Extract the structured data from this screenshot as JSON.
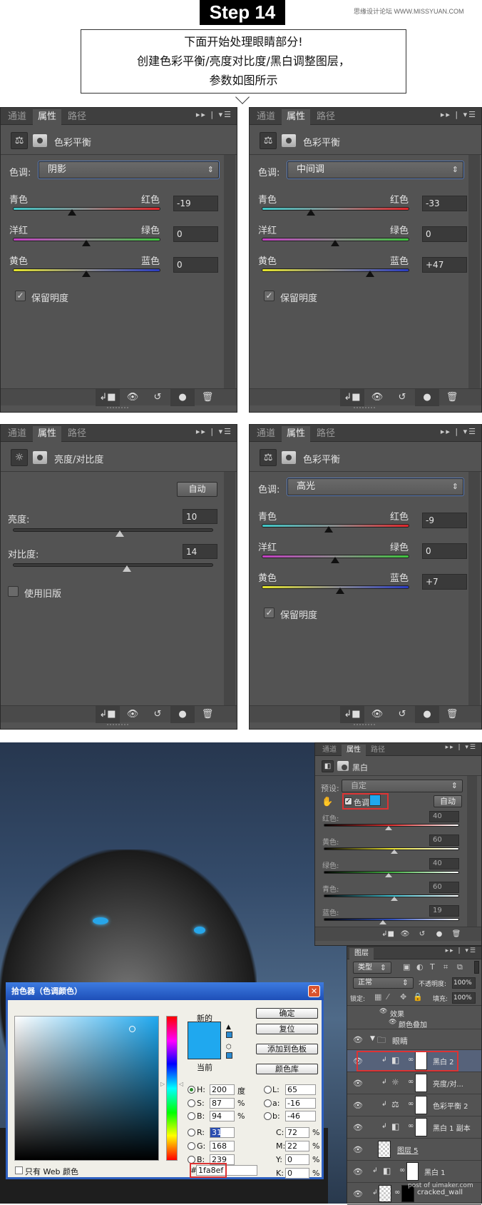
{
  "header": {
    "step": "Step 14",
    "watermark": "思缘设计论坛 WWW.MISSYUAN.COM",
    "callout": [
      "下面开始处理眼睛部分!",
      "创建色彩平衡/亮度对比度/黑白调整图层，",
      "参数如图所示"
    ]
  },
  "panels": [
    {
      "type": "color_balance",
      "tabs": [
        "通道",
        "属性",
        "路径"
      ],
      "title": "色彩平衡",
      "tone_label": "色调:",
      "tone": "阴影",
      "sliders": [
        {
          "left": "青色",
          "right": "红色",
          "value": "-19"
        },
        {
          "left": "洋红",
          "right": "绿色",
          "value": "0"
        },
        {
          "left": "黄色",
          "right": "蓝色",
          "value": "0"
        }
      ],
      "preserve_label": "保留明度",
      "preserve": true
    },
    {
      "type": "color_balance",
      "tabs": [
        "通道",
        "属性",
        "路径"
      ],
      "title": "色彩平衡",
      "tone_label": "色调:",
      "tone": "中间调",
      "sliders": [
        {
          "left": "青色",
          "right": "红色",
          "value": "-33"
        },
        {
          "left": "洋红",
          "right": "绿色",
          "value": "0"
        },
        {
          "left": "黄色",
          "right": "蓝色",
          "value": "+47"
        }
      ],
      "preserve_label": "保留明度",
      "preserve": true
    },
    {
      "type": "brightness_contrast",
      "tabs": [
        "通道",
        "属性",
        "路径"
      ],
      "title": "亮度/对比度",
      "auto": "自动",
      "sliders": [
        {
          "label": "亮度:",
          "value": "10",
          "range": [
            -150,
            150
          ]
        },
        {
          "label": "对比度:",
          "value": "14",
          "range": [
            -100,
            100
          ]
        }
      ],
      "legacy_label": "使用旧版",
      "legacy": false
    },
    {
      "type": "color_balance",
      "tabs": [
        "通道",
        "属性",
        "路径"
      ],
      "title": "色彩平衡",
      "tone_label": "色调:",
      "tone": "高光",
      "sliders": [
        {
          "left": "青色",
          "right": "红色",
          "value": "-9"
        },
        {
          "left": "洋红",
          "right": "绿色",
          "value": "0"
        },
        {
          "left": "黄色",
          "right": "蓝色",
          "value": "+7"
        }
      ],
      "preserve_label": "保留明度",
      "preserve": true
    }
  ],
  "bw_panel": {
    "tabs": [
      "通道",
      "属性",
      "路径"
    ],
    "title": "黑白",
    "preset_label": "预设:",
    "preset": "自定",
    "tint_label": "色调",
    "tint": true,
    "tint_color": "#1fa8ef",
    "auto": "自动",
    "sliders": [
      {
        "label": "红色:",
        "value": "40",
        "color": "#e03030"
      },
      {
        "label": "黄色:",
        "value": "60",
        "color": "#e8e030"
      },
      {
        "label": "绿色:",
        "value": "40",
        "color": "#40b040"
      },
      {
        "label": "青色:",
        "value": "60",
        "color": "#40c0d0"
      },
      {
        "label": "蓝色:",
        "value": "19",
        "color": "#3050c0"
      }
    ]
  },
  "layers": {
    "tab": "图层",
    "filter": "类型",
    "blend": "正常",
    "opacity_label": "不透明度:",
    "opacity": "100%",
    "lock_label": "锁定:",
    "fill_label": "填充:",
    "fill": "100%",
    "effects": "效果",
    "effect_item": "颜色叠加",
    "group": "眼睛",
    "rows": [
      {
        "name": "黑白 2",
        "kind": "bw",
        "selected": true
      },
      {
        "name": "亮度/对...",
        "kind": "brightness"
      },
      {
        "name": "色彩平衡 2",
        "kind": "balance"
      },
      {
        "name": "黑白 1 副本",
        "kind": "bw"
      },
      {
        "name": "图层 5",
        "kind": "pixel"
      },
      {
        "name": "黑白 1",
        "kind": "bw"
      },
      {
        "name": "cracked_wall",
        "kind": "pixel"
      }
    ]
  },
  "picker": {
    "title": "拾色器（色调颜色）",
    "new_label": "新的",
    "current_label": "当前",
    "color": "#1fa8ef",
    "buttons": [
      "确定",
      "复位",
      "添加到色板",
      "颜色库"
    ],
    "hsb": [
      {
        "label": "H:",
        "value": "200",
        "unit": "度",
        "selected": true
      },
      {
        "label": "S:",
        "value": "87",
        "unit": "%"
      },
      {
        "label": "B:",
        "value": "94",
        "unit": "%"
      }
    ],
    "rgb": [
      {
        "label": "R:",
        "value": "31"
      },
      {
        "label": "G:",
        "value": "168"
      },
      {
        "label": "B:",
        "value": "239"
      }
    ],
    "lab": [
      {
        "label": "L:",
        "value": "65"
      },
      {
        "label": "a:",
        "value": "-16"
      },
      {
        "label": "b:",
        "value": "-46"
      }
    ],
    "cmyk": [
      {
        "label": "C:",
        "value": "72",
        "unit": "%"
      },
      {
        "label": "M:",
        "value": "22",
        "unit": "%"
      },
      {
        "label": "Y:",
        "value": "0",
        "unit": "%"
      },
      {
        "label": "K:",
        "value": "0",
        "unit": "%"
      }
    ],
    "hex_label": "#",
    "hex": "1fa8ef",
    "web_only_label": "只有 Web 颜色"
  },
  "photo_watermark": "post of uimaker.com"
}
